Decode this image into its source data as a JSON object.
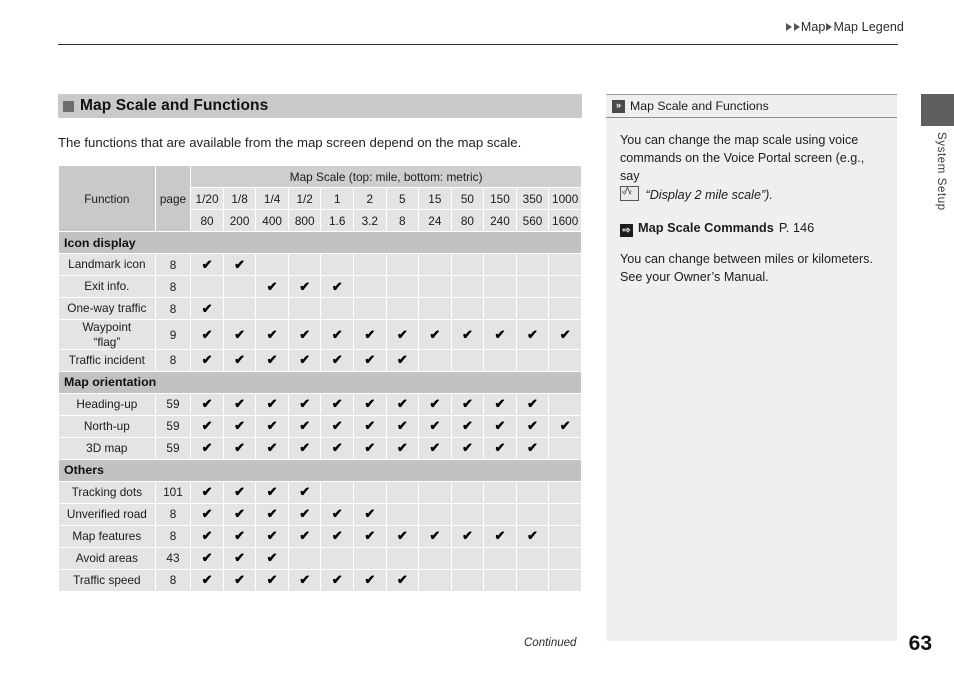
{
  "breadcrumb": {
    "items": [
      "Map",
      "Map Legend"
    ],
    "separator_icon": "triangle-right-icon"
  },
  "section": {
    "heading": "Map Scale and Functions",
    "intro": "The functions that are available from the map screen depend on the map scale."
  },
  "table": {
    "col_function": "Function",
    "col_page": "page",
    "scale_header": "Map Scale (top: mile, bottom: metric)",
    "scales_mile": [
      "1/20",
      "1/8",
      "1/4",
      "1/2",
      "1",
      "2",
      "5",
      "15",
      "50",
      "150",
      "350",
      "1000"
    ],
    "scales_metric": [
      "80",
      "200",
      "400",
      "800",
      "1.6",
      "3.2",
      "8",
      "24",
      "80",
      "240",
      "560",
      "1600"
    ],
    "check_glyph": "✔",
    "groups": [
      {
        "label": "Icon display",
        "rows": [
          {
            "function": "Landmark icon",
            "page": "8",
            "checks": [
              1,
              1,
              0,
              0,
              0,
              0,
              0,
              0,
              0,
              0,
              0,
              0
            ]
          },
          {
            "function": "Exit info.",
            "page": "8",
            "checks": [
              0,
              0,
              1,
              1,
              1,
              0,
              0,
              0,
              0,
              0,
              0,
              0
            ]
          },
          {
            "function": "One-way traffic",
            "page": "8",
            "checks": [
              1,
              0,
              0,
              0,
              0,
              0,
              0,
              0,
              0,
              0,
              0,
              0
            ]
          },
          {
            "function": "Waypoint\n“flag”",
            "page": "9",
            "checks": [
              1,
              1,
              1,
              1,
              1,
              1,
              1,
              1,
              1,
              1,
              1,
              1
            ]
          },
          {
            "function": "Traffic incident",
            "page": "8",
            "checks": [
              1,
              1,
              1,
              1,
              1,
              1,
              1,
              0,
              0,
              0,
              0,
              0
            ]
          }
        ]
      },
      {
        "label": "Map orientation",
        "rows": [
          {
            "function": "Heading-up",
            "page": "59",
            "checks": [
              1,
              1,
              1,
              1,
              1,
              1,
              1,
              1,
              1,
              1,
              1,
              0
            ]
          },
          {
            "function": "North-up",
            "page": "59",
            "checks": [
              1,
              1,
              1,
              1,
              1,
              1,
              1,
              1,
              1,
              1,
              1,
              1
            ]
          },
          {
            "function": "3D map",
            "page": "59",
            "checks": [
              1,
              1,
              1,
              1,
              1,
              1,
              1,
              1,
              1,
              1,
              1,
              0
            ]
          }
        ]
      },
      {
        "label": "Others",
        "rows": [
          {
            "function": "Tracking dots",
            "page": "101",
            "checks": [
              1,
              1,
              1,
              1,
              0,
              0,
              0,
              0,
              0,
              0,
              0,
              0
            ]
          },
          {
            "function": "Unverified road",
            "page": "8",
            "checks": [
              1,
              1,
              1,
              1,
              1,
              1,
              0,
              0,
              0,
              0,
              0,
              0
            ]
          },
          {
            "function": "Map features",
            "page": "8",
            "checks": [
              1,
              1,
              1,
              1,
              1,
              1,
              1,
              1,
              1,
              1,
              1,
              0
            ]
          },
          {
            "function": "Avoid areas",
            "page": "43",
            "checks": [
              1,
              1,
              1,
              0,
              0,
              0,
              0,
              0,
              0,
              0,
              0,
              0
            ]
          },
          {
            "function": "Traffic speed",
            "page": "8",
            "checks": [
              1,
              1,
              1,
              1,
              1,
              1,
              1,
              0,
              0,
              0,
              0,
              0
            ]
          }
        ]
      }
    ]
  },
  "sidebar": {
    "header": "Map Scale and Functions",
    "header_icon": "double-chevron-right-icon",
    "para1_a": "You can change the map scale using voice commands on the Voice Portal screen (e.g., say",
    "voice_icon": "voice-command-icon",
    "para1_quote": "“Display 2 mile scale”).",
    "ref_label": "Map Scale Commands",
    "ref_page": "P. 146",
    "ref_icon": "arrow-link-icon",
    "para2": "You can change between miles or kilometers. See your Owner’s Manual."
  },
  "edge_tab": {
    "label": "System Setup"
  },
  "footer": {
    "continued": "Continued",
    "page_number": "63"
  }
}
